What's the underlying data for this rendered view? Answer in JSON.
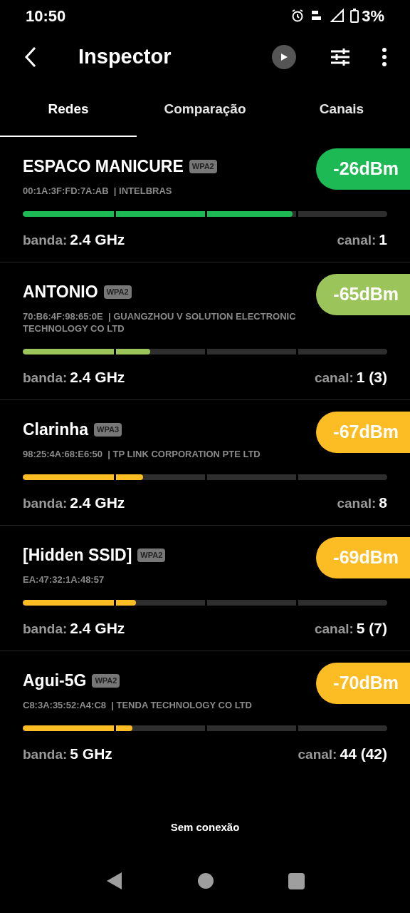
{
  "status_bar": {
    "time": "10:50",
    "battery": "3%"
  },
  "app_bar": {
    "title": "Inspector"
  },
  "tabs": [
    {
      "label": "Redes",
      "selected": true
    },
    {
      "label": "Comparação",
      "selected": false
    },
    {
      "label": "Canais",
      "selected": false
    }
  ],
  "networks": [
    {
      "name": "ESPACO MANICURE",
      "security": "WPA2",
      "mac": "00:1A:3F:FD:7A:AB  | INTELBRAS",
      "signal": "-26dBm",
      "color": "#1db954",
      "level": 0.74,
      "band_label": "banda:",
      "band": "2.4 GHz",
      "channel_label": "canal:",
      "channel": "1"
    },
    {
      "name": "ANTONIO",
      "security": "WPA2",
      "mac": "70:B6:4F:98:65:0E  | GUANGZHOU V SOLUTION ELECTRONIC TECHNOLOGY CO LTD",
      "signal": "-65dBm",
      "color": "#9bc45a",
      "level": 0.35,
      "band_label": "banda:",
      "band": "2.4 GHz",
      "channel_label": "canal:",
      "channel": "1 (3)"
    },
    {
      "name": "Clarinha",
      "security": "WPA3",
      "mac": "98:25:4A:68:E6:50  | TP LINK CORPORATION PTE LTD",
      "signal": "-67dBm",
      "color": "#fbbd23",
      "level": 0.33,
      "band_label": "banda:",
      "band": "2.4 GHz",
      "channel_label": "canal:",
      "channel": "8"
    },
    {
      "name": "[Hidden SSID]",
      "security": "WPA2",
      "mac": "EA:47:32:1A:48:57",
      "signal": "-69dBm",
      "color": "#fbbd23",
      "level": 0.31,
      "band_label": "banda:",
      "band": "2.4 GHz",
      "channel_label": "canal:",
      "channel": "5 (7)"
    },
    {
      "name": "Agui-5G",
      "security": "WPA2",
      "mac": "C8:3A:35:52:A4:C8  | TENDA TECHNOLOGY CO LTD",
      "signal": "-70dBm",
      "color": "#fbbd23",
      "level": 0.3,
      "band_label": "banda:",
      "band": "5 GHz",
      "channel_label": "canal:",
      "channel": "44 (42)"
    }
  ],
  "connection_status": "Sem conexão"
}
